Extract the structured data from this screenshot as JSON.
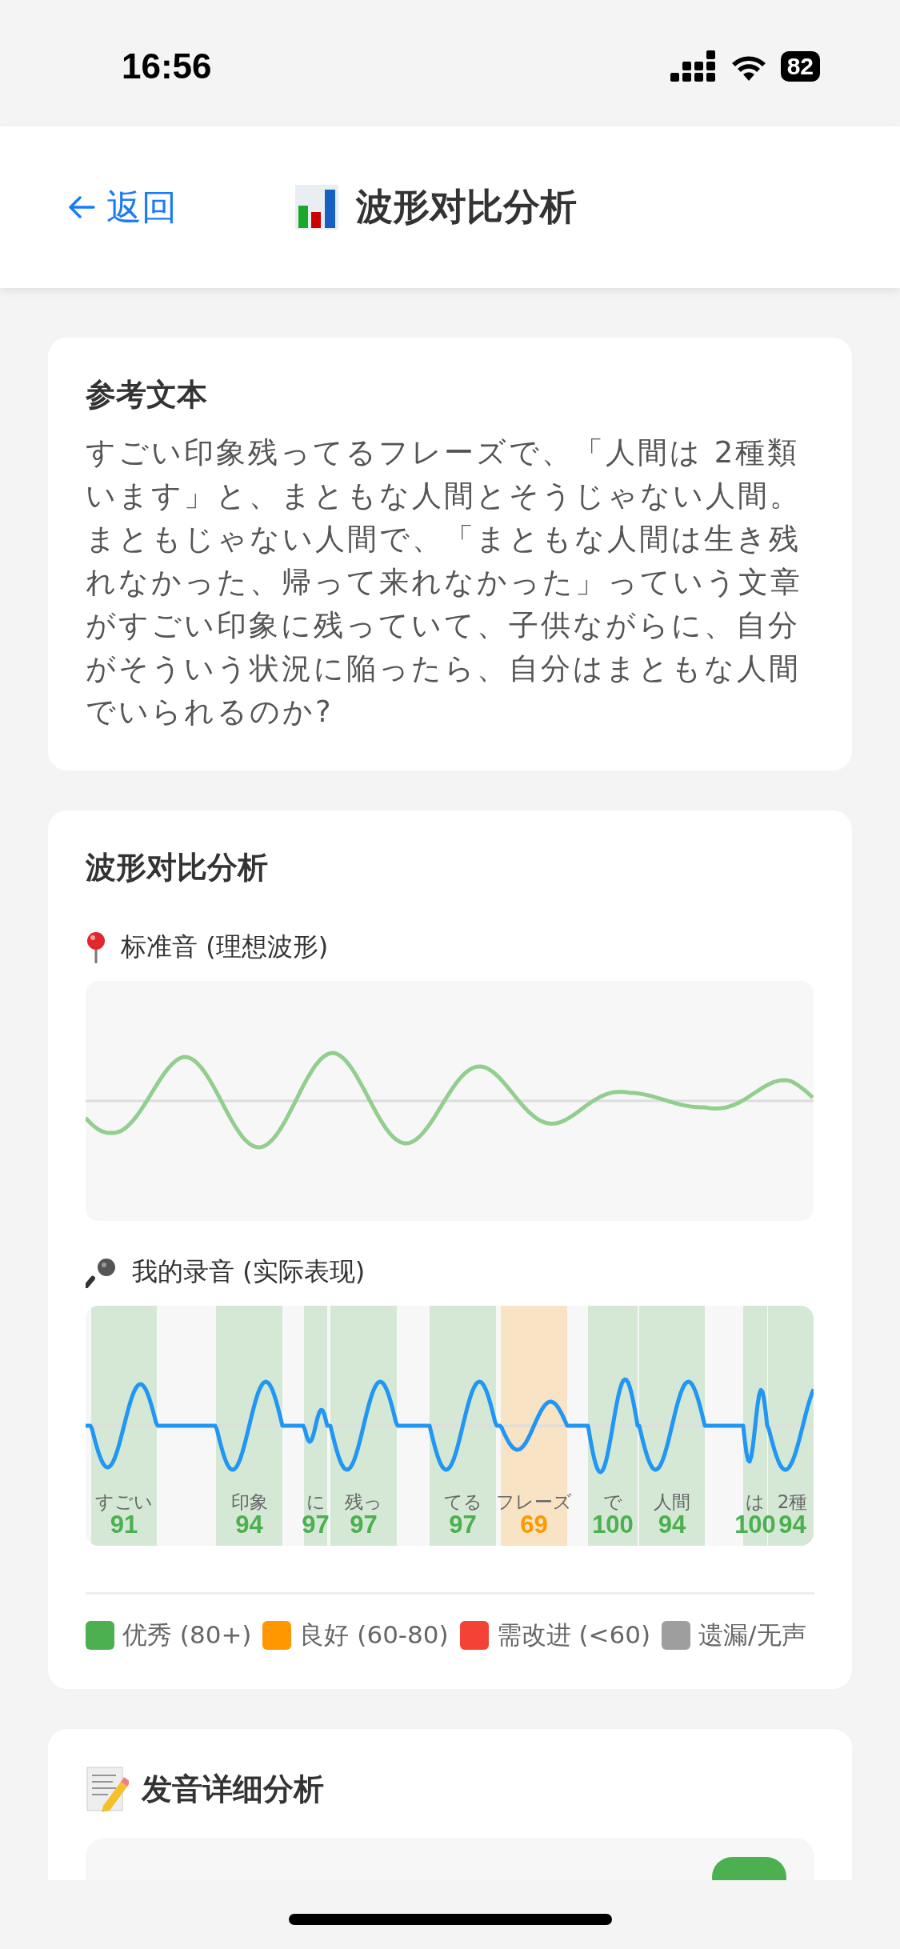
{
  "status_bar": {
    "time": "16:56",
    "battery": "82"
  },
  "header": {
    "back": "返回",
    "title": "波形对比分析"
  },
  "reference": {
    "title": "参考文本",
    "text": "すごい印象残ってるフレーズで、「人間は 2種類います」と、まともな人間とそうじゃない人間。まともじゃない人間で、「まともな人間は生き残れなかった、帰って来れなかった」っていう文章がすごい印象に残っていて、子供ながらに、自分がそういう状況に陥ったら、自分はまともな人間でいられるのか?"
  },
  "waveform": {
    "title": "波形对比分析",
    "standard_label": "标准音 (理想波形)",
    "recording_label": "我的录音 (实际表现)",
    "segments": [
      {
        "word": "すごい",
        "score": "91",
        "color": "#4caf50"
      },
      {
        "word": "印象",
        "score": "94",
        "color": "#4caf50"
      },
      {
        "word": "に",
        "score": "97",
        "color": "#4caf50"
      },
      {
        "word": "残っ",
        "score": "97",
        "color": "#4caf50"
      },
      {
        "word": "てる",
        "score": "97",
        "color": "#4caf50"
      },
      {
        "word": "フレーズ",
        "score": "69",
        "color": "#ff9800"
      },
      {
        "word": "で",
        "score": "100",
        "color": "#4caf50"
      },
      {
        "word": "人間",
        "score": "94",
        "color": "#4caf50"
      },
      {
        "word": "は",
        "score": "100",
        "color": "#4caf50"
      },
      {
        "word": "2種",
        "score": "94",
        "color": "#4caf50"
      }
    ],
    "legend": [
      {
        "label": "优秀 (80+)",
        "color": "#4caf50"
      },
      {
        "label": "良好 (60-80)",
        "color": "#ff9800"
      },
      {
        "label": "需改进 (<60)",
        "color": "#f44336"
      },
      {
        "label": "遗漏/无声",
        "color": "#9e9e9e"
      }
    ]
  },
  "detail": {
    "title": "发音详细分析"
  }
}
